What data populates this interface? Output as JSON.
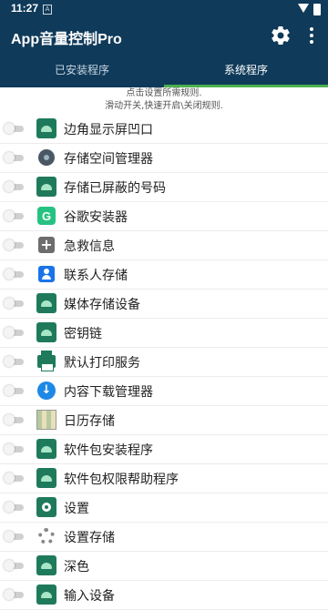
{
  "status_bar": {
    "time": "11:27",
    "notif_letter": "A"
  },
  "app_bar": {
    "title": "App音量控制Pro",
    "settings_icon": "gear-icon",
    "more_icon": "more-vert-icon"
  },
  "tabs": [
    {
      "label": "已安装程序"
    },
    {
      "label": "系统程序"
    }
  ],
  "hint": {
    "line1": "点击设置所需规则.",
    "line2": "滑动开关,快速开启\\关闭规则."
  },
  "colors": {
    "appbar": "#0f3a5a",
    "indicator": "#4caf50"
  },
  "apps": [
    {
      "label": "边角显示屏凹口",
      "icon": "android-icon",
      "enabled": false
    },
    {
      "label": "存储空间管理器",
      "icon": "storage-icon",
      "enabled": false
    },
    {
      "label": "存储已屏蔽的号码",
      "icon": "android-icon",
      "enabled": false
    },
    {
      "label": "谷歌安装器",
      "icon": "installer-icon",
      "enabled": false
    },
    {
      "label": "急救信息",
      "icon": "emergency-icon",
      "enabled": false
    },
    {
      "label": "联系人存储",
      "icon": "contacts-icon",
      "enabled": false
    },
    {
      "label": "媒体存储设备",
      "icon": "android-icon",
      "enabled": false
    },
    {
      "label": "密钥链",
      "icon": "android-icon",
      "enabled": false
    },
    {
      "label": "默认打印服务",
      "icon": "print-icon",
      "enabled": false
    },
    {
      "label": "内容下载管理器",
      "icon": "download-icon",
      "enabled": false
    },
    {
      "label": "日历存储",
      "icon": "calendar-icon",
      "enabled": false
    },
    {
      "label": "软件包安装程序",
      "icon": "android-icon",
      "enabled": false
    },
    {
      "label": "软件包权限帮助程序",
      "icon": "android-icon",
      "enabled": false
    },
    {
      "label": "设置",
      "icon": "settings-icon",
      "enabled": false
    },
    {
      "label": "设置存储",
      "icon": "gear-icon",
      "enabled": false
    },
    {
      "label": "深色",
      "icon": "android-icon",
      "enabled": false
    },
    {
      "label": "输入设备",
      "icon": "android-icon",
      "enabled": false
    }
  ]
}
